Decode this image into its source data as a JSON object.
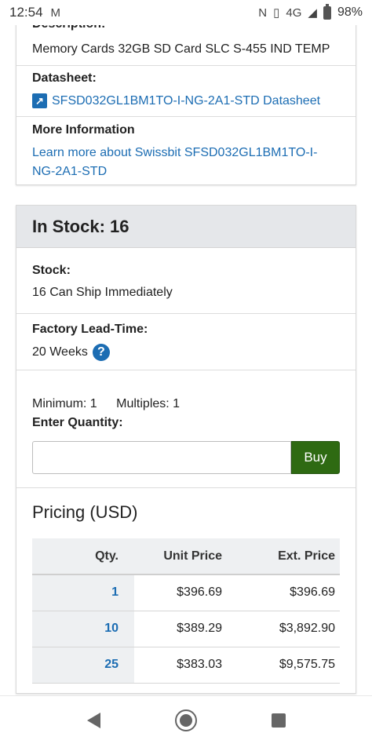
{
  "status_bar": {
    "time": "12:54",
    "mail_icon": "gmail-icon",
    "network": "4G",
    "battery": "98%"
  },
  "product": {
    "description_label": "Description:",
    "description_value": "Memory Cards 32GB SD Card SLC S-455 IND TEMP",
    "datasheet_label": "Datasheet:",
    "datasheet_link": "SFSD032GL1BM1TO-I-NG-2A1-STD Datasheet",
    "more_info_label": "More Information",
    "more_info_link": "Learn more about Swissbit SFSD032GL1BM1TO-I-NG-2A1-STD"
  },
  "stock": {
    "heading": "In Stock: 16",
    "stock_label": "Stock:",
    "stock_value": "16 Can Ship Immediately",
    "lead_label": "Factory Lead-Time:",
    "lead_value": "20 Weeks",
    "minimum": "Minimum: 1",
    "multiples": "Multiples: 1",
    "enter_qty_label": "Enter Quantity:",
    "qty_value": "",
    "buy_label": "Buy"
  },
  "pricing": {
    "title": "Pricing (USD)",
    "headers": [
      "Qty.",
      "Unit Price",
      "Ext. Price"
    ],
    "rows": [
      {
        "qty": "1",
        "unit": "$396.69",
        "ext": "$396.69"
      },
      {
        "qty": "10",
        "unit": "$389.29",
        "ext": "$3,892.90"
      },
      {
        "qty": "25",
        "unit": "$383.03",
        "ext": "$9,575.75"
      }
    ]
  },
  "nav": {
    "back_icon": "back-triangle-icon",
    "home_icon": "home-circle-icon",
    "recents_icon": "recents-square-icon"
  }
}
